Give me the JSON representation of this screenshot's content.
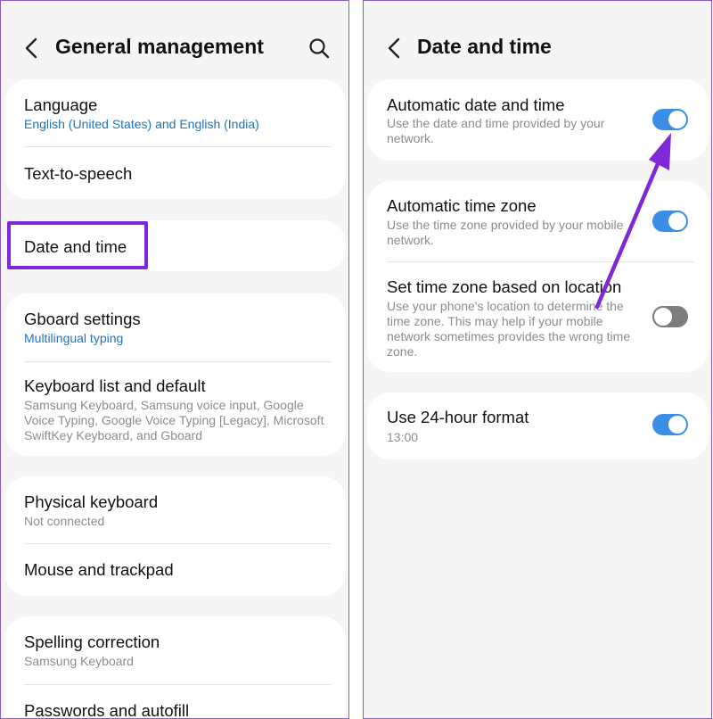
{
  "left_screen": {
    "header": {
      "title": "General management",
      "back_icon": "chevron-left-icon",
      "search_icon": "search-icon"
    },
    "items": {
      "language": {
        "title": "Language",
        "subtitle": "English (United States) and English (India)"
      },
      "tts": {
        "title": "Text-to-speech"
      },
      "date_time": {
        "title": "Date and time"
      },
      "gboard": {
        "title": "Gboard settings",
        "subtitle": "Multilingual typing"
      },
      "keyboard_list": {
        "title": "Keyboard list and default",
        "subtitle": "Samsung Keyboard, Samsung voice input, Google Voice Typing, Google Voice Typing [Legacy], Microsoft SwiftKey Keyboard, and Gboard"
      },
      "physical_keyboard": {
        "title": "Physical keyboard",
        "subtitle": "Not connected"
      },
      "mouse": {
        "title": "Mouse and trackpad"
      },
      "spelling": {
        "title": "Spelling correction",
        "subtitle": "Samsung Keyboard"
      },
      "passwords": {
        "title": "Passwords and autofill"
      }
    }
  },
  "right_screen": {
    "header": {
      "title": "Date and time",
      "back_icon": "chevron-left-icon"
    },
    "items": {
      "auto_date_time": {
        "title": "Automatic date and time",
        "subtitle": "Use the date and time provided by your network.",
        "enabled": true
      },
      "auto_time_zone": {
        "title": "Automatic time zone",
        "subtitle": "Use the time zone provided by your mobile network.",
        "enabled": true
      },
      "location_time_zone": {
        "title": "Set time zone based on location",
        "subtitle": "Use your phone's location to determine the time zone. This may help if your mobile network sometimes provides the wrong time zone.",
        "enabled": false
      },
      "format_24h": {
        "title": "Use 24-hour format",
        "subtitle": "13:00",
        "enabled": true
      }
    }
  },
  "colors": {
    "highlight": "#7f28d8",
    "toggle_on": "#3a8ee6",
    "toggle_off": "#7d7d7d",
    "link_blue": "#1e73be",
    "background": "#f5f5f5"
  }
}
